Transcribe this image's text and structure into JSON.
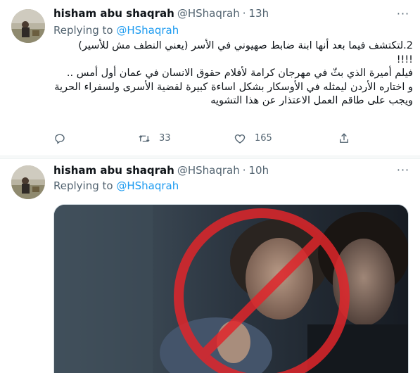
{
  "tweets": [
    {
      "author_name": "hisham abu shaqrah",
      "author_handle": "@HShaqrah",
      "separator": "·",
      "time": "13h",
      "replying_prefix": "Replying to ",
      "replying_handle": "@HShaqrah",
      "text_lines": [
        "2.لتكتشف فيما بعد أنها ابنة ضابط صهيوني في الأسر (يعني النطف مش للأسير)",
        "!!!!",
        "فيلم أميرة الذي بثّ في مهرجان كرامة لأفلام حقوق الانسان في عمان أول أمس ..",
        "و اختاره الأردن ليمثله في الأوسكار بشكل اساءة كبيرة لقضية الأسرى ولسفراء الحرية",
        "ويجب على طاقم العمل الاعتذار عن هذا التشويه"
      ],
      "actions": {
        "reply_count": "",
        "retweet_count": "33",
        "like_count": "165"
      }
    },
    {
      "author_name": "hisham abu shaqrah",
      "author_handle": "@HShaqrah",
      "separator": "·",
      "time": "10h",
      "replying_prefix": "Replying to ",
      "replying_handle": "@HShaqrah"
    }
  ],
  "icons": {
    "more": "more-horizontal-icon",
    "reply": "reply-icon",
    "retweet": "retweet-icon",
    "like": "heart-icon",
    "share": "share-icon"
  },
  "colors": {
    "link": "#1d9bf0",
    "secondary": "#536471",
    "text": "#0f1419",
    "prohibition": "#e0262b"
  }
}
